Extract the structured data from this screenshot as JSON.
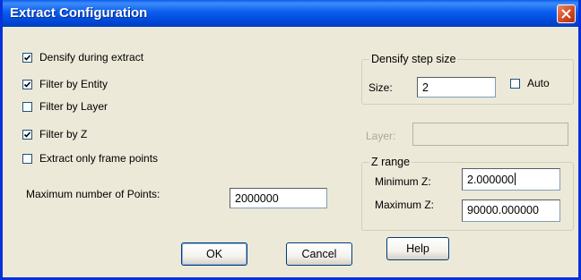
{
  "window": {
    "title": "Extract Configuration",
    "close_glyph": "close-icon"
  },
  "options": [
    {
      "label": "Densify during extract",
      "checked": true
    },
    {
      "label": "Filter by Entity",
      "checked": true
    },
    {
      "label": "Filter by Layer",
      "checked": false
    },
    {
      "label": "Filter by Z",
      "checked": true
    },
    {
      "label": "Extract only frame points",
      "checked": false
    }
  ],
  "max_points": {
    "label": "Maximum number of Points:",
    "value": "2000000"
  },
  "densify_group": {
    "title": "Densify step size",
    "size_label": "Size:",
    "size_value": "2",
    "auto_label": "Auto",
    "auto_checked": false
  },
  "layer": {
    "label": "Layer:",
    "value": "",
    "enabled": false
  },
  "z_range": {
    "title": "Z range",
    "min_label": "Minimum Z:",
    "min_value": "2.000000",
    "max_label": "Maximum Z:",
    "max_value": "90000.000000"
  },
  "buttons": {
    "ok": "OK",
    "cancel": "Cancel",
    "help": "Help"
  },
  "colors": {
    "title_bar": "#0a5ef0",
    "dialog_bg": "#ece9d8",
    "close_button": "#d1451f"
  }
}
